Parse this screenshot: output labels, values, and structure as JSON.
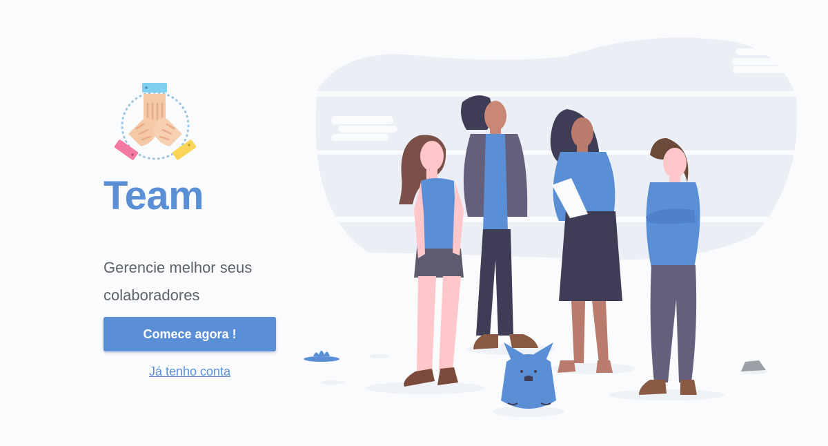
{
  "app": {
    "title": "Team",
    "tagline": "Gerencie melhor seus colaboradores"
  },
  "actions": {
    "start_label": "Comece agora !",
    "login_label": "Já tenho conta"
  },
  "theme": {
    "accent": "#5a8fd6",
    "background": "#fafbfc",
    "text_muted": "#5f6368"
  },
  "icons": {
    "logo": "team-hands-icon",
    "illustration": "team-people-illustration"
  }
}
